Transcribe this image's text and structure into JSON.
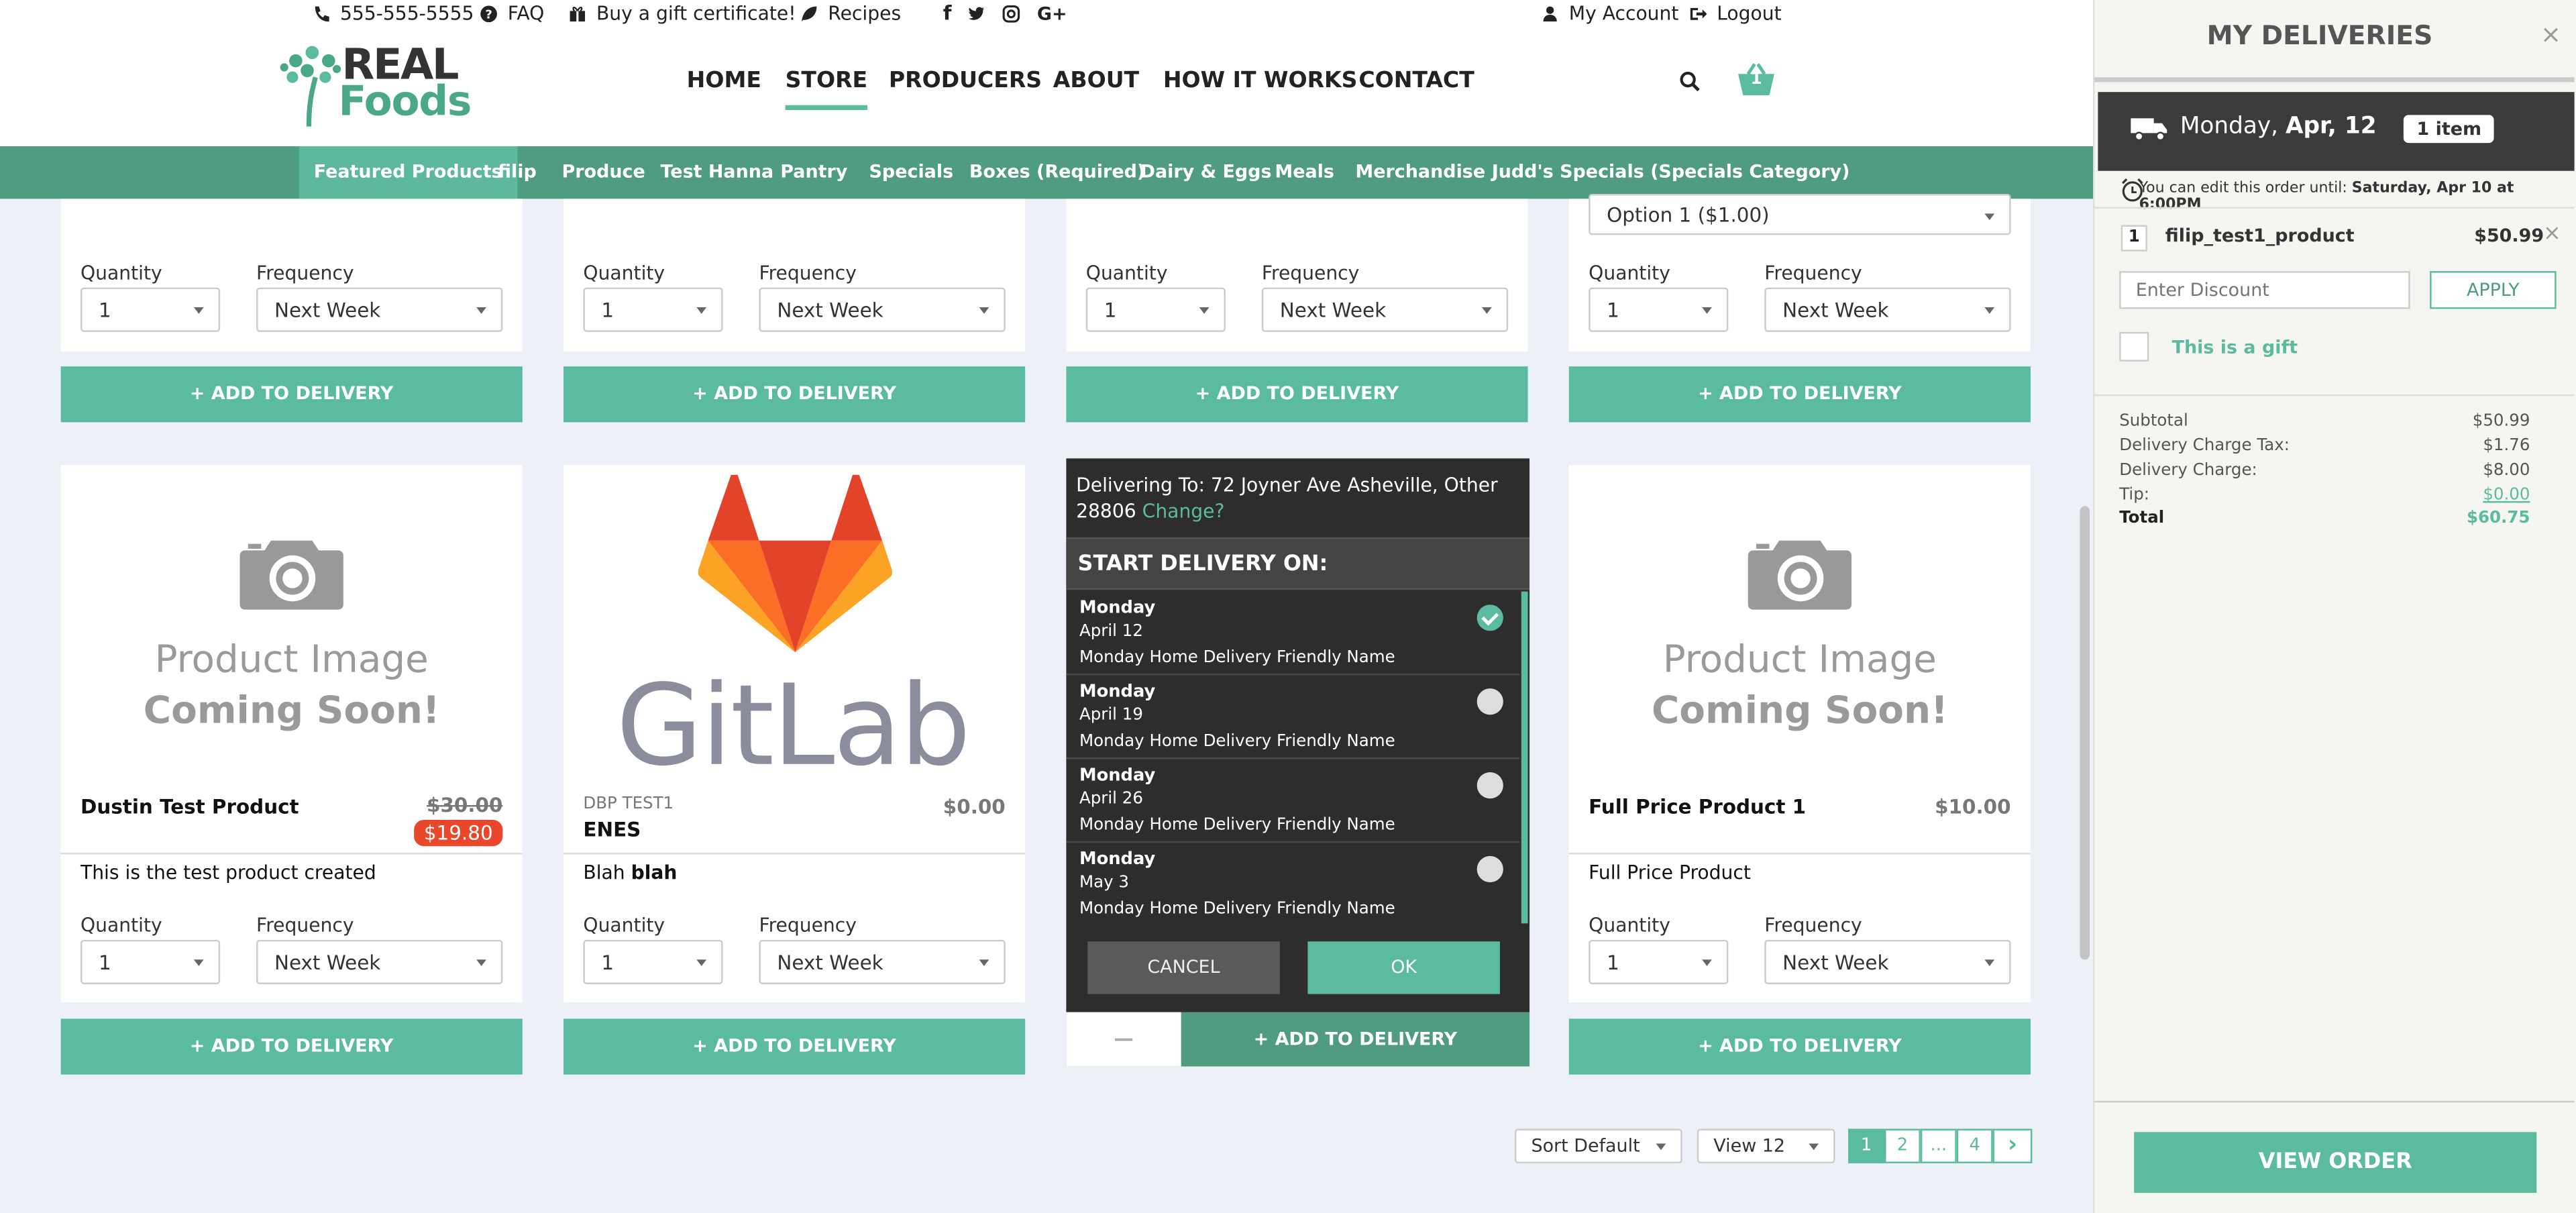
{
  "topbar": {
    "phone": "555-555-5555",
    "faq": "FAQ",
    "gift": "Buy a gift certificate!",
    "recipes": "Recipes",
    "my_account": "My Account",
    "logout": "Logout"
  },
  "logo": {
    "line1": "REAL",
    "line2": "Foods"
  },
  "nav": [
    "HOME",
    "STORE",
    "PRODUCERS",
    "ABOUT",
    "HOW IT WORKS",
    "CONTACT"
  ],
  "cart_count": "1",
  "categories": [
    "Featured Products",
    "filip",
    "Produce",
    "Test Hanna",
    "Pantry",
    "Specials",
    "Boxes (Required)",
    "Dairy & Eggs",
    "Meals",
    "Merchandise",
    "Judd's Specials (Specials Category)"
  ],
  "common": {
    "quantity": "Quantity",
    "frequency": "Frequency",
    "qty_value": "1",
    "freq_value": "Next Week",
    "add_btn": "+ ADD TO DELIVERY"
  },
  "row1_option": "Option 1 ($1.00)",
  "placeholder": {
    "line1": "Product Image",
    "line2": "Coming Soon!"
  },
  "products": [
    {
      "name": "Dustin Test Product",
      "old_price": "$30.00",
      "sale_price": "$19.80",
      "desc": "This is the test product created"
    },
    {
      "producer": "DBP TEST1",
      "name": "ENES",
      "price": "$0.00",
      "desc_a": "Blah ",
      "desc_b": "blah",
      "logo_text": "GitLab"
    },
    {
      "name": "Full Price Product 1",
      "price": "$10.00",
      "desc": "Full Price Product"
    }
  ],
  "popup": {
    "address": "Delivering To: 72 Joyner Ave Asheville, Other 28806",
    "change": "Change?",
    "heading": "START DELIVERY ON:",
    "dates": [
      {
        "day": "Monday",
        "date": "April 12",
        "name": "Monday Home Delivery Friendly Name",
        "selected": true
      },
      {
        "day": "Monday",
        "date": "April 19",
        "name": "Monday Home Delivery Friendly Name",
        "selected": false
      },
      {
        "day": "Monday",
        "date": "April 26",
        "name": "Monday Home Delivery Friendly Name",
        "selected": false
      },
      {
        "day": "Monday",
        "date": "May 3",
        "name": "Monday Home Delivery Friendly Name",
        "selected": false
      }
    ],
    "cancel": "CANCEL",
    "ok": "OK",
    "minus": "—",
    "add": "+ ADD TO DELIVERY"
  },
  "pagination": {
    "sort": "Sort Default",
    "view": "View 12",
    "pages": [
      "1",
      "2",
      "...",
      "4"
    ],
    "next": "›"
  },
  "panel": {
    "title": "MY DELIVERIES",
    "close": "×",
    "day": "Monday, ",
    "date": "Apr, 12",
    "items": "1 item",
    "edit_note": "You can edit this order until: ",
    "edit_until": "Saturday, Apr 10 at 6:00PM",
    "line_qty": "1",
    "line_name": "filip_test1_product",
    "line_price": "$50.99",
    "discount_placeholder": "Enter Discount",
    "apply": "APPLY",
    "gift_label": "This is a gift",
    "summary": [
      {
        "label": "Subtotal",
        "value": "$50.99"
      },
      {
        "label": "Delivery Charge Tax:",
        "value": "$1.76"
      },
      {
        "label": "Delivery Charge:",
        "value": "$8.00"
      },
      {
        "label": "Tip:",
        "value": "$0.00"
      },
      {
        "label": "Total",
        "value": "$60.75"
      }
    ],
    "view_order": "VIEW ORDER"
  },
  "colors": {
    "accent": "#5bbba0",
    "catbar": "#4f9c82",
    "sale": "#e8472c"
  }
}
